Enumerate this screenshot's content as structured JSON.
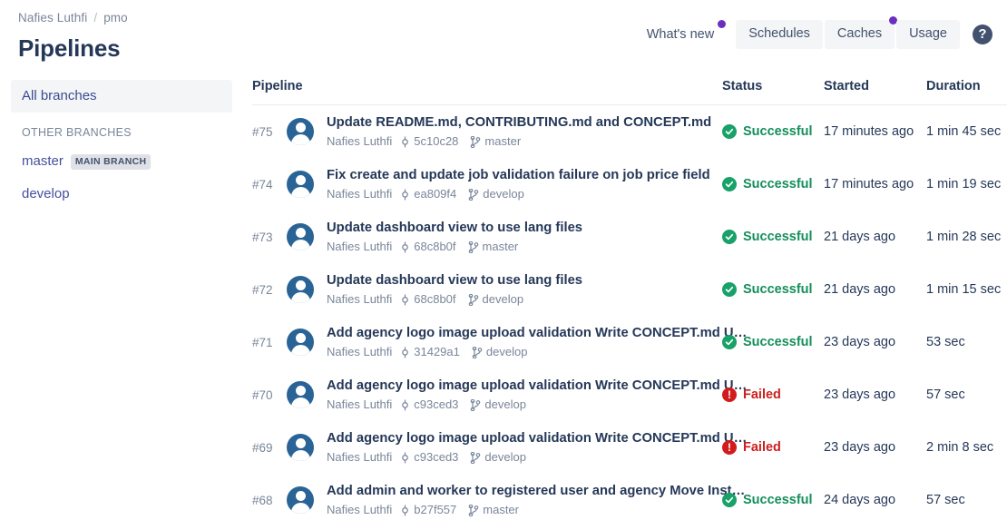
{
  "header": {
    "breadcrumb": {
      "workspace": "Nafies Luthfi",
      "separator": "/",
      "repo": "pmo"
    },
    "title": "Pipelines",
    "whats_new": "What's new",
    "buttons": [
      {
        "label": "Schedules",
        "badge": false
      },
      {
        "label": "Caches",
        "badge": true
      },
      {
        "label": "Usage",
        "badge": false
      }
    ],
    "help_label": "?",
    "badge_color": "#6b2fbf"
  },
  "sidebar": {
    "all_branches": "All branches",
    "other_heading": "OTHER BRANCHES",
    "branches": [
      {
        "name": "master",
        "badge": "MAIN BRANCH"
      },
      {
        "name": "develop",
        "badge": ""
      }
    ]
  },
  "table": {
    "columns": {
      "pipeline": "Pipeline",
      "status": "Status",
      "started": "Started",
      "duration": "Duration"
    },
    "rows": [
      {
        "id": "#75",
        "title": "Update README.md, CONTRIBUTING.md and CONCEPT.md",
        "author": "Nafies Luthfi",
        "commit": "5c10c28",
        "branch": "master",
        "status": "Successful",
        "status_kind": "ok",
        "started": "17 minutes ago",
        "duration": "1 min 45 sec"
      },
      {
        "id": "#74",
        "title": "Fix create and update job validation failure on job price field",
        "author": "Nafies Luthfi",
        "commit": "ea809f4",
        "branch": "develop",
        "status": "Successful",
        "status_kind": "ok",
        "started": "17 minutes ago",
        "duration": "1 min 19 sec"
      },
      {
        "id": "#73",
        "title": "Update dashboard view to use lang files",
        "author": "Nafies Luthfi",
        "commit": "68c8b0f",
        "branch": "master",
        "status": "Successful",
        "status_kind": "ok",
        "started": "21 days ago",
        "duration": "1 min 28 sec"
      },
      {
        "id": "#72",
        "title": "Update dashboard view to use lang files",
        "author": "Nafies Luthfi",
        "commit": "68c8b0f",
        "branch": "develop",
        "status": "Successful",
        "status_kind": "ok",
        "started": "21 days ago",
        "duration": "1 min 15 sec"
      },
      {
        "id": "#71",
        "title": "Add agency logo image upload validation Write CONCEPT.md U…",
        "author": "Nafies Luthfi",
        "commit": "31429a1",
        "branch": "develop",
        "status": "Successful",
        "status_kind": "ok",
        "started": "23 days ago",
        "duration": "53 sec"
      },
      {
        "id": "#70",
        "title": "Add agency logo image upload validation Write CONCEPT.md U…",
        "author": "Nafies Luthfi",
        "commit": "c93ced3",
        "branch": "develop",
        "status": "Failed",
        "status_kind": "fail",
        "started": "23 days ago",
        "duration": "57 sec"
      },
      {
        "id": "#69",
        "title": "Add agency logo image upload validation Write CONCEPT.md U…",
        "author": "Nafies Luthfi",
        "commit": "c93ced3",
        "branch": "develop",
        "status": "Failed",
        "status_kind": "fail",
        "started": "23 days ago",
        "duration": "2 min 8 sec"
      },
      {
        "id": "#68",
        "title": "Add admin and worker to registered user and agency Move Inst…",
        "author": "Nafies Luthfi",
        "commit": "b27f557",
        "branch": "master",
        "status": "Successful",
        "status_kind": "ok",
        "started": "24 days ago",
        "duration": "57 sec"
      }
    ]
  },
  "colors": {
    "success": "#148f5b",
    "failed": "#cc1f1f",
    "accent_purple": "#6b2fbf",
    "text": "#253858"
  }
}
